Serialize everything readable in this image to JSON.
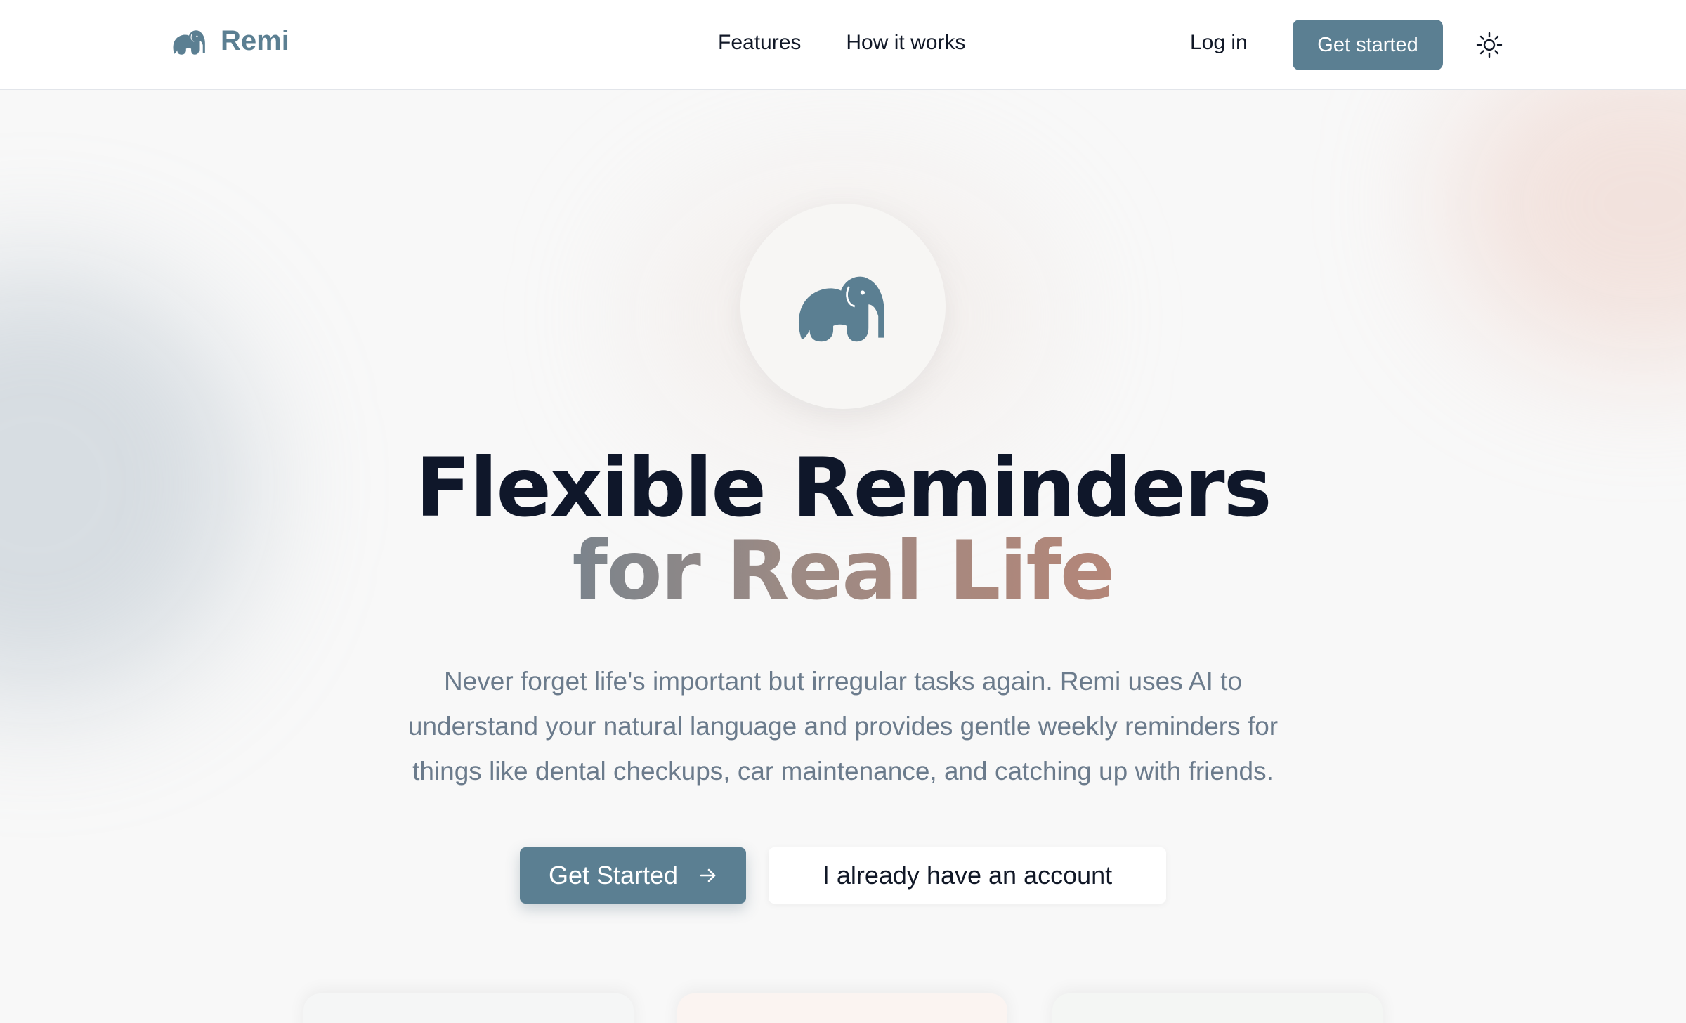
{
  "header": {
    "brand_name": "Remi",
    "nav": [
      {
        "label": "Features"
      },
      {
        "label": "How it works"
      }
    ],
    "login_label": "Log in",
    "cta_label": "Get started",
    "theme_icon": "sun-icon"
  },
  "hero": {
    "logo_icon": "elephant-icon",
    "headline_line1": "Flexible Reminders",
    "headline_line2": "for Real Life",
    "description": "Never forget life's important but irregular tasks again. Remi uses AI to understand your natural language and provides gentle weekly reminders for things like dental checkups, car maintenance, and catching up with friends.",
    "primary_button": "Get Started",
    "primary_button_icon": "arrow-right-icon",
    "secondary_button": "I already have an account"
  },
  "colors": {
    "brand": "#5b7f92",
    "headline": "#0f172a",
    "subtext": "#6b7b8c",
    "gradient_start": "#7b848c",
    "gradient_end": "#b48678"
  }
}
